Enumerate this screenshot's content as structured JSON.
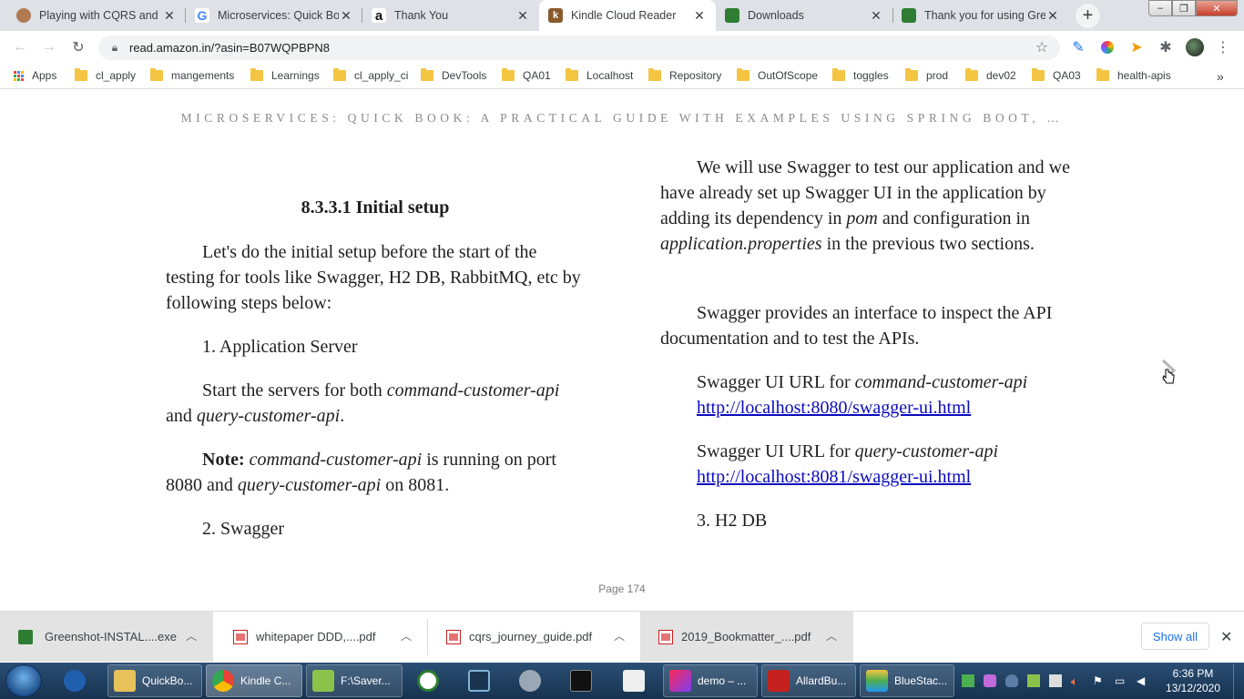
{
  "browser": {
    "tabs": [
      {
        "title": "Playing with CQRS and E",
        "favicon": "avatar-icon",
        "active": false
      },
      {
        "title": "Microservices: Quick Boo",
        "favicon": "google-icon",
        "active": false
      },
      {
        "title": "Thank You",
        "favicon": "amazon-icon",
        "active": false
      },
      {
        "title": "Kindle Cloud Reader",
        "favicon": "kindle-icon",
        "active": true
      },
      {
        "title": "Downloads",
        "favicon": "greenshot-icon",
        "active": false
      },
      {
        "title": "Thank you for using Gre",
        "favicon": "greenshot-icon",
        "active": false
      }
    ],
    "address": "read.amazon.in/?asin=B07WQPBPN8",
    "bookmarks": [
      "Apps",
      "cl_apply",
      "mangements",
      "Learnings",
      "cl_apply_ci",
      "DevTools",
      "QA01",
      "Localhost",
      "Repository",
      "OutOfScope",
      "toggles",
      "prod",
      "dev02",
      "QA03",
      "health-apis"
    ]
  },
  "reader": {
    "book_header": "MICROSERVICES: QUICK BOOK: A PRACTICAL GUIDE WITH EXAMPLES USING SPRING BOOT, …",
    "left": {
      "heading": "8.3.3.1 Initial setup",
      "intro": "Let's do the initial setup before the start of the testing for tools like Swagger, H2 DB, RabbitMQ, etc by following steps below:",
      "step1": "1. Application Server",
      "start_pre": "Start the servers for both ",
      "start_cmd": "command-customer-api",
      "start_and": " and ",
      "start_query": "query-customer-api",
      "start_end": ".",
      "note_label": "Note:",
      "note_cmd": "command-customer-api",
      "note_mid": " is running on port 8080 and ",
      "note_query": "query-customer-api",
      "note_end": " on 8081.",
      "step2": "2. Swagger"
    },
    "right": {
      "p1_a": "We will use Swagger to test our application and we have already set up Swagger UI in the application by adding its dependency in ",
      "p1_pom": "pom",
      "p1_b": " and configuration in ",
      "p1_props": "application.properties",
      "p1_c": " in the previous two sections.",
      "p2": "Swagger provides an interface to inspect the API documentation and to test the APIs.",
      "url1_label": "Swagger UI URL for ",
      "url1_api": "command-customer-api",
      "url1_link": "http://localhost:8080/swagger-ui.html",
      "url2_label": "Swagger UI URL for ",
      "url2_api": "query-customer-api",
      "url2_link": "http://localhost:8081/swagger-ui.html",
      "step3": "3. H2 DB"
    },
    "page_number": "Page 174"
  },
  "downloads": {
    "items": [
      {
        "name": "Greenshot-INSTAL....exe",
        "icon": "exe-icon"
      },
      {
        "name": "whitepaper DDD,....pdf",
        "icon": "pdf-icon"
      },
      {
        "name": "cqrs_journey_guide.pdf",
        "icon": "pdf-icon"
      },
      {
        "name": "2019_Bookmatter_....pdf",
        "icon": "pdf-icon"
      }
    ],
    "show_all": "Show all"
  },
  "taskbar": {
    "items": [
      {
        "label": "QuickBo..."
      },
      {
        "label": "Kindle C..."
      },
      {
        "label": "F:\\Saver..."
      },
      {
        "label": "demo – ..."
      },
      {
        "label": "AllardBu..."
      },
      {
        "label": "BlueStac..."
      }
    ],
    "time": "6:36 PM",
    "date": "13/12/2020"
  }
}
